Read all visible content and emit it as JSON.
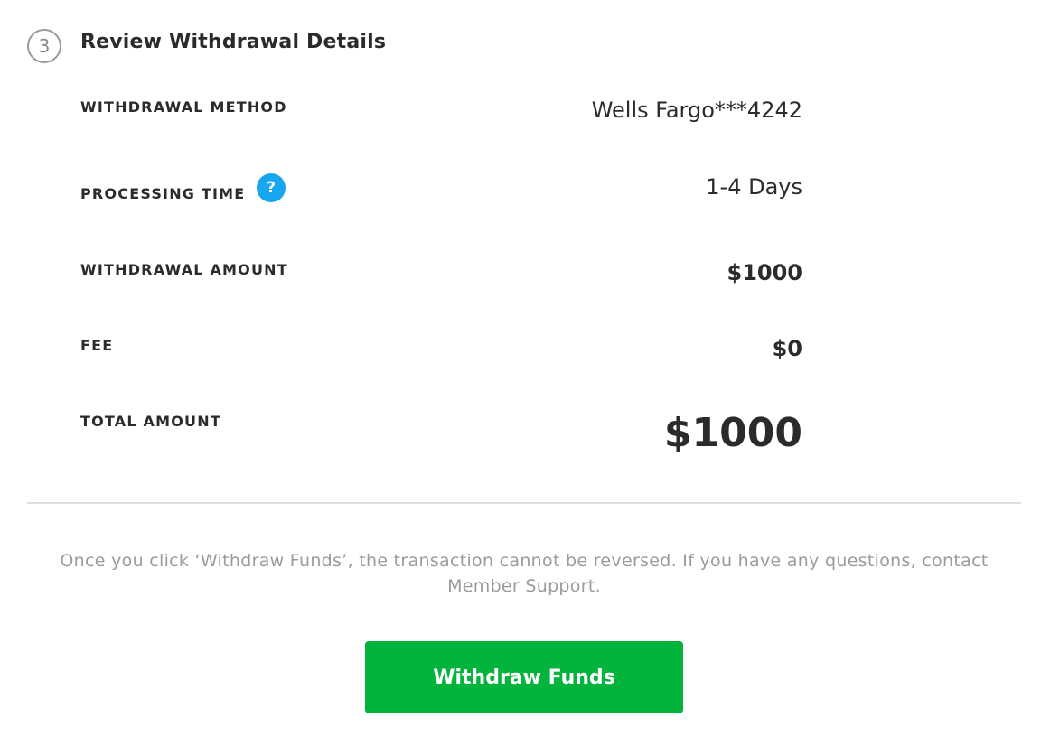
{
  "step": {
    "number": "3",
    "title": "Review Withdrawal Details"
  },
  "details": {
    "withdrawal_method": {
      "label": "WITHDRAWAL METHOD",
      "value": "Wells Fargo***4242"
    },
    "processing_time": {
      "label": "PROCESSING TIME",
      "help": "?",
      "value": "1-4 Days"
    },
    "withdrawal_amount": {
      "label": "WITHDRAWAL AMOUNT",
      "value": "$1000"
    },
    "fee": {
      "label": "FEE",
      "value": "$0"
    },
    "total_amount": {
      "label": "TOTAL AMOUNT",
      "value": "$1000"
    }
  },
  "disclaimer": "Once you click ‘Withdraw Funds’, the transaction cannot be reversed. If you have any questions, contact Member Support.",
  "button": {
    "label": "Withdraw Funds"
  },
  "colors": {
    "accent_green": "#02b43c",
    "help_blue": "#18a6ef",
    "muted_text": "#9b9b9b",
    "divider": "#dedede"
  }
}
